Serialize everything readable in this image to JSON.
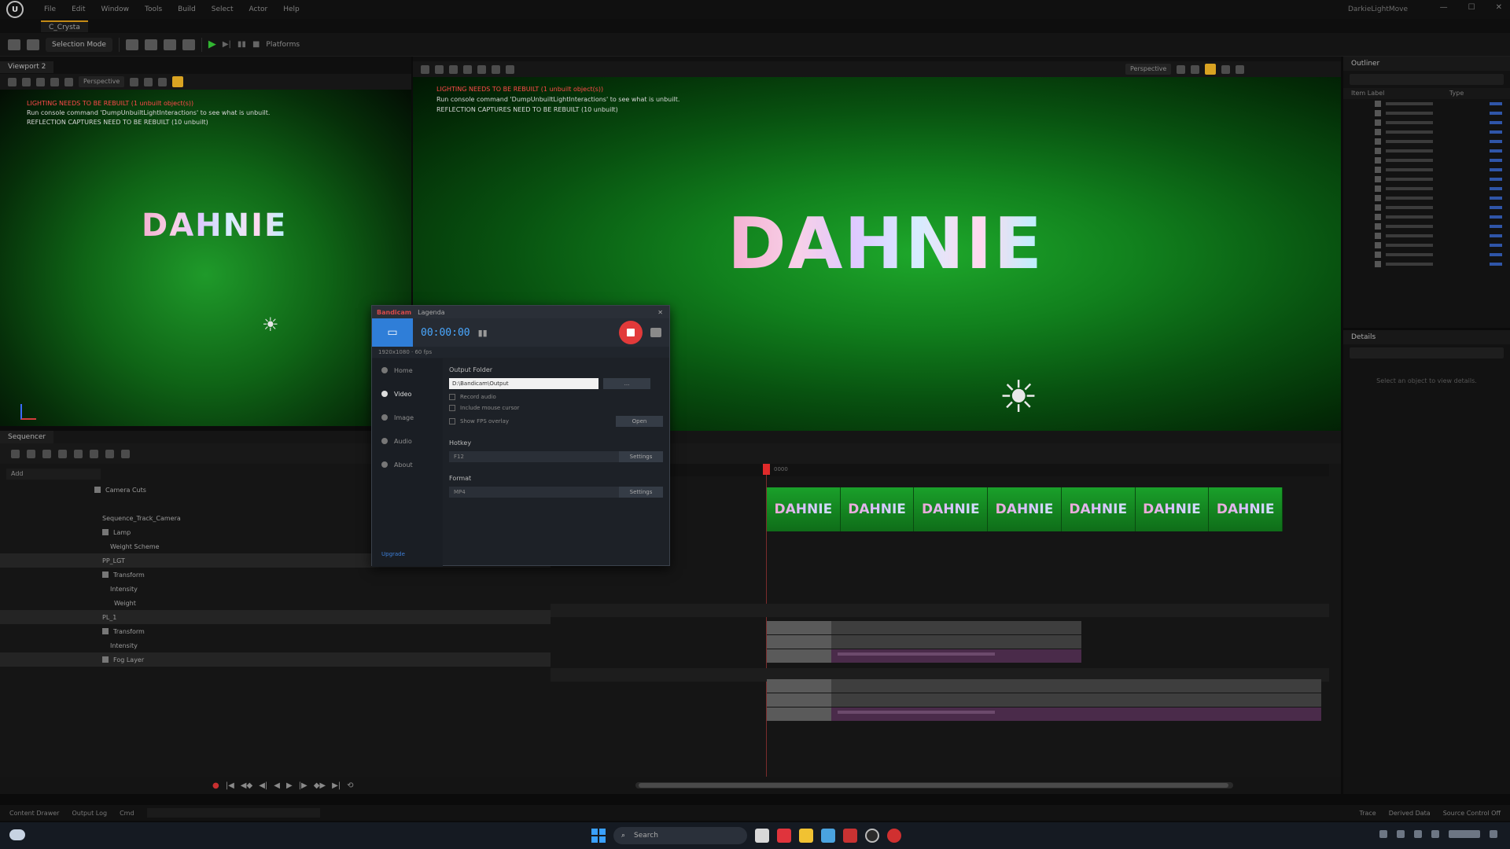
{
  "app": {
    "logo": "U",
    "level_tab": "C_Crysta",
    "project": "DarkieLightMove"
  },
  "menu": [
    "File",
    "Edit",
    "Window",
    "Tools",
    "Build",
    "Select",
    "Actor",
    "Help"
  ],
  "toolbar": {
    "mode": "Selection Mode",
    "platforms": "Platforms"
  },
  "viewports": {
    "left_tab": "Viewport 2",
    "left_view": "Perspective",
    "main_view": "Perspective",
    "warnings": [
      "LIGHTING NEEDS TO BE REBUILT (1 unbuilt object(s))",
      "Run console command 'DumpUnbuiltLightInteractions' to see what is unbuilt.",
      "REFLECTION CAPTURES NEED TO BE REBUILT (10 unbuilt)"
    ],
    "scene_text": "DAHNIE"
  },
  "outliner": {
    "title": "Outliner",
    "col_label": "Item Label",
    "col_type": "Type",
    "details_title": "Details",
    "details_empty": "Select an object to view details."
  },
  "sequencer": {
    "tab": "Sequencer",
    "filter": "Add",
    "tracks": [
      "Camera Cuts",
      "Sequence_Track_Camera",
      "Lamp",
      "Weight Scheme",
      "PP_LGT",
      "Transform",
      "Intensity",
      "Weight",
      "PL_1",
      "Transform",
      "Intensity",
      "Fog Layer"
    ],
    "clip_label": "DAHNIE",
    "start_label": "0000"
  },
  "recorder": {
    "brand": "Bandicam",
    "title_extra": "Lagenda",
    "timer": "00:00:00",
    "sub": "1920x1080 · 60 fps",
    "side": [
      "Home",
      "Video",
      "Image",
      "Audio",
      "About"
    ],
    "output_label": "Output Folder",
    "output_path": "D:\\Bandicam\\Output",
    "browse": "...",
    "open": "Open",
    "checks": [
      "Record audio",
      "Include mouse cursor",
      "Show FPS overlay"
    ],
    "hotkey_label": "Hotkey",
    "hotkey_value": "F12",
    "format_label": "Format",
    "format_value": "MP4",
    "settings": "Settings",
    "footer": "Upgrade"
  },
  "statusbar": [
    "Content Drawer",
    "Output Log",
    "Cmd"
  ],
  "status_right": [
    "Trace",
    "Derived Data",
    "Source Control Off"
  ],
  "taskbar": {
    "search": "Search"
  },
  "colors": {
    "accent": "#c48a15",
    "record": "#e23a3a",
    "timeline_clip": "#1aa02a",
    "recorder_blue": "#2f7ed8"
  }
}
